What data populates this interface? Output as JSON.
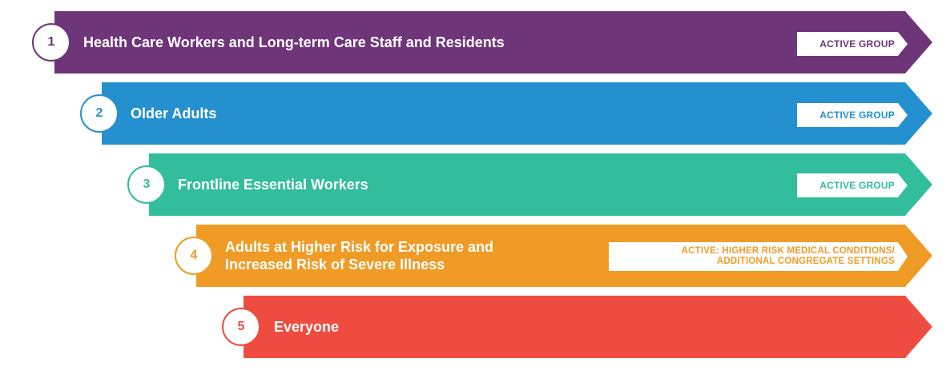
{
  "colors": {
    "group1": "#6e3679",
    "group2": "#2590cf",
    "group3": "#32bd9d",
    "group4": "#ef9b26",
    "group5": "#ef4c41"
  },
  "groups": [
    {
      "number": "1",
      "title": "Health Care Workers and Long-term Care Staff and Residents",
      "status": "ACTIVE GROUP"
    },
    {
      "number": "2",
      "title": "Older Adults",
      "status": "ACTIVE GROUP"
    },
    {
      "number": "3",
      "title": "Frontline Essential Workers",
      "status": "ACTIVE GROUP"
    },
    {
      "number": "4",
      "title_line1": "Adults at Higher Risk for Exposure and",
      "title_line2": "Increased Risk of Severe Illness",
      "status_line1": "ACTIVE: HIGHER RISK MEDICAL CONDITIONS/",
      "status_line2": "ADDITIONAL CONGREGATE SETTINGS"
    },
    {
      "number": "5",
      "title": "Everyone"
    }
  ]
}
